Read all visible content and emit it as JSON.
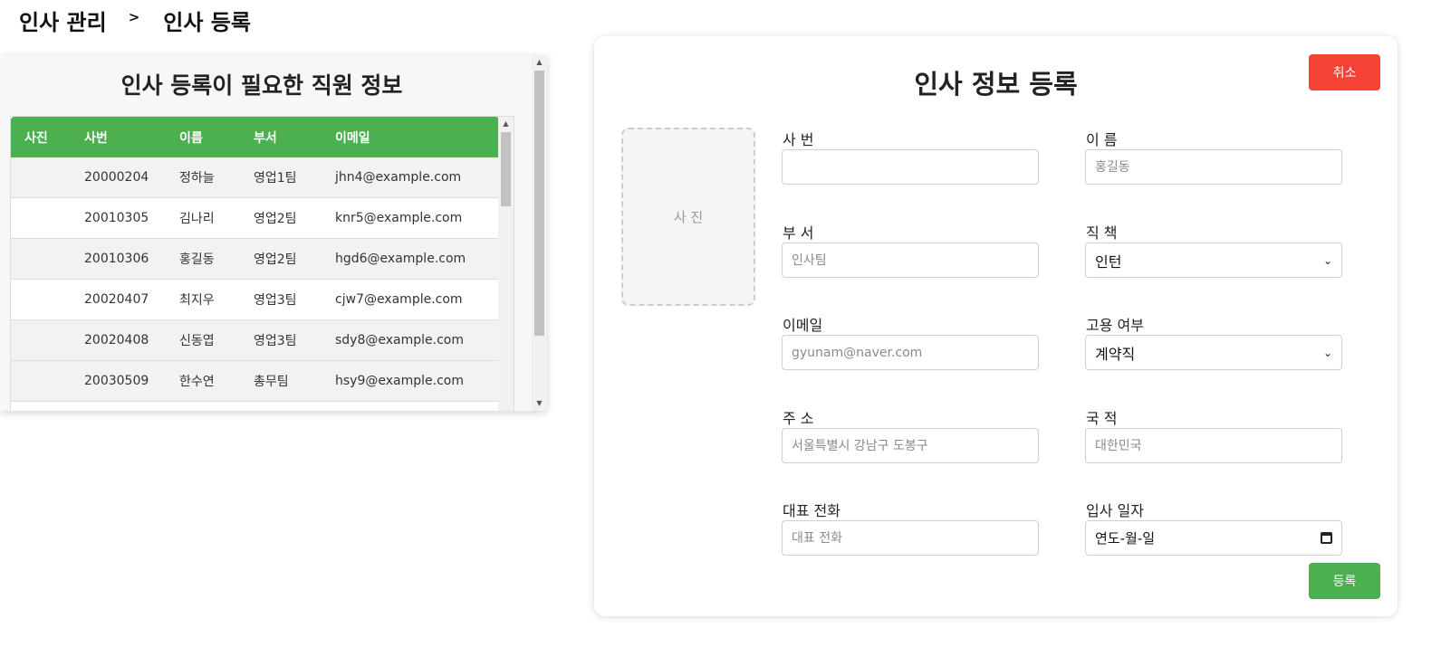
{
  "breadcrumb": {
    "parent": "인사 관리",
    "separator": ">",
    "current": "인사 등록"
  },
  "left_panel": {
    "title": "인사 등록이 필요한 직원 정보",
    "columns": [
      "사진",
      "사번",
      "이름",
      "부서",
      "이메일"
    ],
    "rows": [
      {
        "photo": "",
        "id": "20000204",
        "name": "정하늘",
        "dept": "영업1팀",
        "email": "jhn4@example.com"
      },
      {
        "photo": "",
        "id": "20010305",
        "name": "김나리",
        "dept": "영업2팀",
        "email": "knr5@example.com"
      },
      {
        "photo": "",
        "id": "20010306",
        "name": "홍길동",
        "dept": "영업2팀",
        "email": "hgd6@example.com"
      },
      {
        "photo": "",
        "id": "20020407",
        "name": "최지우",
        "dept": "영업3팀",
        "email": "cjw7@example.com"
      },
      {
        "photo": "",
        "id": "20020408",
        "name": "신동엽",
        "dept": "영업3팀",
        "email": "sdy8@example.com"
      },
      {
        "photo": "",
        "id": "20030509",
        "name": "한수연",
        "dept": "총무팀",
        "email": "hsy9@example.com"
      }
    ]
  },
  "form": {
    "title": "인사 정보 등록",
    "cancel_label": "취소",
    "submit_label": "등록",
    "photo_label": "사 진",
    "fields": {
      "emp_id": {
        "label": "사 번",
        "value": "",
        "placeholder": ""
      },
      "name": {
        "label": "이 름",
        "value": "",
        "placeholder": "홍길동"
      },
      "dept": {
        "label": "부 서",
        "value": "",
        "placeholder": "인사팀"
      },
      "position": {
        "label": "직 책",
        "selected": "인턴"
      },
      "email": {
        "label": "이메일",
        "value": "",
        "placeholder": "gyunam@naver.com"
      },
      "employment": {
        "label": "고용 여부",
        "selected": "계약직"
      },
      "address": {
        "label": "주 소",
        "value": "",
        "placeholder": "서울특별시 강남구 도봉구"
      },
      "nationality": {
        "label": "국 적",
        "value": "",
        "placeholder": "대한민국"
      },
      "phone": {
        "label": "대표 전화",
        "value": "",
        "placeholder": "대표 전화"
      },
      "hire_date": {
        "label": "입사 일자",
        "display": "연도-월-일"
      }
    }
  },
  "colors": {
    "header_green": "#4caf50",
    "cancel_red": "#f44336",
    "submit_green": "#4caf50"
  }
}
